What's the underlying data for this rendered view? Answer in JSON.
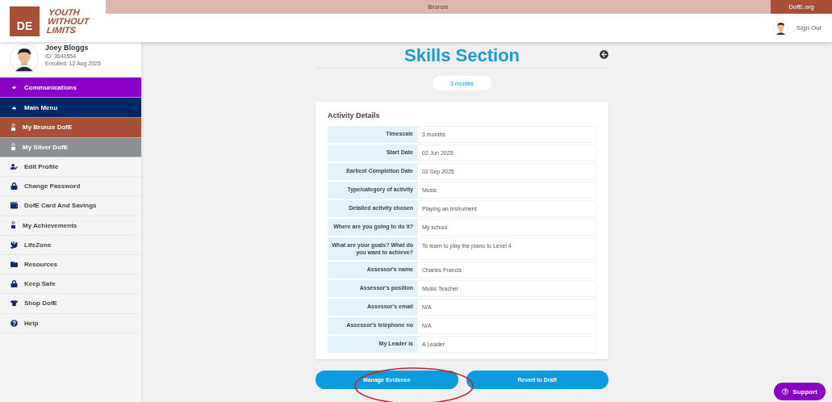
{
  "top_bar": {
    "level": "Bronze",
    "link": "DofE.org"
  },
  "logo": {
    "mark": "DE",
    "tagline_lines": [
      "YOUTH",
      "WITHOUT",
      "LIMITS"
    ]
  },
  "header": {
    "sign_out": "Sign Out"
  },
  "profile": {
    "name": "Joey Bloggs",
    "id": "ID: 3640554",
    "enrolled": "Enrolled: 12 Aug 2025"
  },
  "menu": [
    {
      "kind": "header",
      "label": "Communications",
      "color": "#8a00c8",
      "expanded": false
    },
    {
      "kind": "header",
      "label": "Main Menu",
      "color": "#002766",
      "expanded": true
    },
    {
      "kind": "award",
      "label": "My Bronze DofE",
      "color": "#a94f36"
    },
    {
      "kind": "award",
      "label": "My Silver DofE",
      "color": "#8c8f93"
    },
    {
      "kind": "link",
      "label": "Edit Profile"
    },
    {
      "kind": "link",
      "label": "Change Password"
    },
    {
      "kind": "link",
      "label": "DofE Card And Savings"
    },
    {
      "kind": "link",
      "label": "My Achievements"
    },
    {
      "kind": "link",
      "label": "LifeZone"
    },
    {
      "kind": "link",
      "label": "Resources"
    },
    {
      "kind": "link",
      "label": "Keep Safe"
    },
    {
      "kind": "link",
      "label": "Shop DofE"
    },
    {
      "kind": "link",
      "label": "Help"
    }
  ],
  "page": {
    "title": "Skills Section",
    "timescale_pill": "3 months"
  },
  "card": {
    "title": "Activity Details",
    "rows": [
      {
        "label": "Timescale",
        "value": "3 months"
      },
      {
        "label": "Start Date",
        "value": "02 Jun 2025"
      },
      {
        "label": "Earliest Completion Date",
        "value": "02 Sep 2025"
      },
      {
        "label": "Type/category of activity",
        "value": "Music"
      },
      {
        "label": "Detailed activity chosen",
        "value": "Playing an Instrument"
      },
      {
        "label": "Where are you going to do it?",
        "value": "My school"
      },
      {
        "label": "What are your goals? What do you want to achieve?",
        "value": "To learn to play the piano to Level 4"
      },
      {
        "label": "Assessor's name",
        "value": "Charles Francis"
      },
      {
        "label": "Assessor's position",
        "value": "Music Teacher"
      },
      {
        "label": "Assessor's email",
        "value": "N/A"
      },
      {
        "label": "Assessor's telephone no",
        "value": "N/A"
      },
      {
        "label": "My Leader is",
        "value": "A Leader"
      }
    ]
  },
  "buttons": [
    "Manage Evidence",
    "Revert to Draft"
  ],
  "support": "Support",
  "annotation": {
    "kind": "ellipse",
    "color": "#d91c1c"
  }
}
